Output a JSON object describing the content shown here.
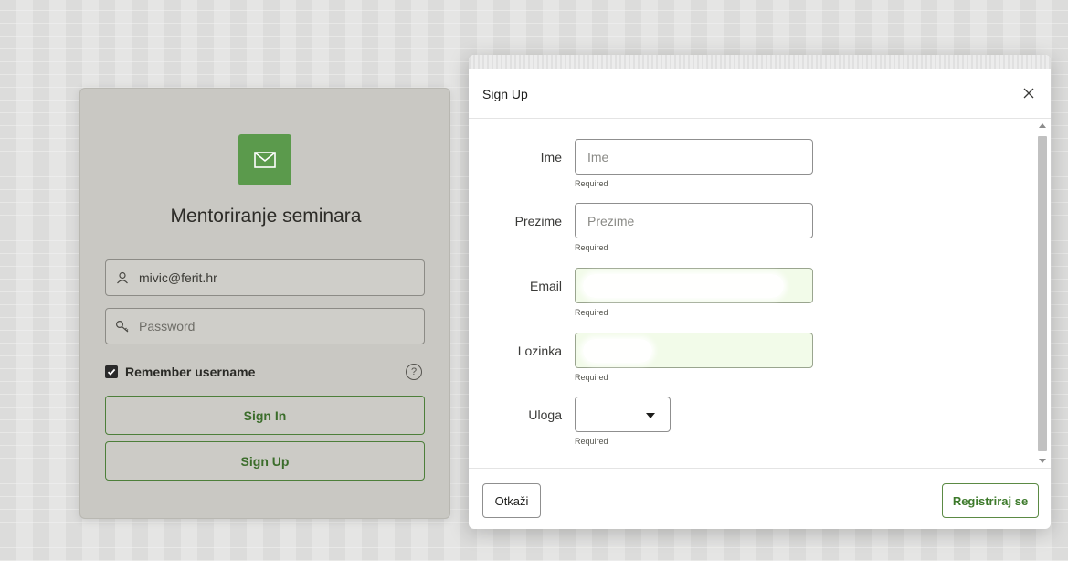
{
  "login": {
    "logo_icon": "envelope-icon",
    "app_title": "Mentoriranje seminara",
    "username": {
      "icon": "user-icon",
      "value": "mivic@ferit.hr"
    },
    "password": {
      "icon": "key-icon",
      "placeholder": "Password"
    },
    "remember": {
      "label": "Remember username",
      "checked": true
    },
    "help_icon": "help-icon",
    "help_glyph": "?",
    "sign_in_label": "Sign In",
    "sign_up_label": "Sign Up"
  },
  "dialog": {
    "title": "Sign Up",
    "close_icon": "close-icon",
    "fields": [
      {
        "label": "Ime",
        "placeholder": "Ime",
        "hint": "Required"
      },
      {
        "label": "Prezime",
        "placeholder": "Prezime",
        "hint": "Required"
      },
      {
        "label": "Email",
        "value": "",
        "hint": "Required",
        "autofilled": true
      },
      {
        "label": "Lozinka",
        "value": "",
        "hint": "Required",
        "autofilled": true
      },
      {
        "label": "Uloga",
        "value": "",
        "hint": "Required",
        "type": "select"
      }
    ],
    "cancel_label": "Otkaži",
    "submit_label": "Registriraj se"
  },
  "colors": {
    "accent_green": "#3d7a2b",
    "logo_green": "#5b9a4c",
    "autofill_bg": "#f2fbe9"
  }
}
